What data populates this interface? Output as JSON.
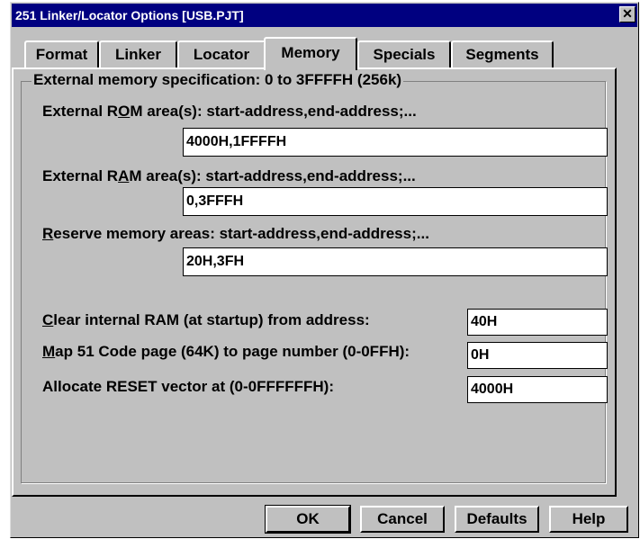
{
  "window": {
    "title": "251 Linker/Locator Options [USB.PJT]",
    "close_glyph": "✕"
  },
  "tabs": [
    {
      "label": "Format"
    },
    {
      "label": "Linker"
    },
    {
      "label": "Locator"
    },
    {
      "label": "Memory",
      "active": true
    },
    {
      "label": "Specials"
    },
    {
      "label": "Segments"
    }
  ],
  "memory": {
    "group_title": "External memory specification: 0 to 3FFFFH (256k)",
    "rom": {
      "label_pre": "External R",
      "label_hot": "O",
      "label_post": "M area(s): start-address,end-address;...",
      "value": "4000H,1FFFFH"
    },
    "ram": {
      "label_pre": "External R",
      "label_hot": "A",
      "label_post": "M area(s): start-address,end-address;...",
      "value": "0,3FFFH"
    },
    "reserve": {
      "label_hot": "R",
      "label_post": "eserve memory areas: start-address,end-address;...",
      "value": "20H,3FH"
    },
    "clear_ram": {
      "label_hot": "C",
      "label_post": "lear internal RAM (at startup) from address:",
      "value": "40H"
    },
    "map51": {
      "label_hot": "M",
      "label_post": "ap 51 Code page (64K) to page number (0-0FFH):",
      "value": "0H"
    },
    "reset_vector": {
      "label": "Allocate RESET vector at (0-0FFFFFFH):",
      "value": "4000H"
    }
  },
  "buttons": {
    "ok": "OK",
    "cancel": "Cancel",
    "defaults": "Defaults",
    "help": "Help"
  }
}
